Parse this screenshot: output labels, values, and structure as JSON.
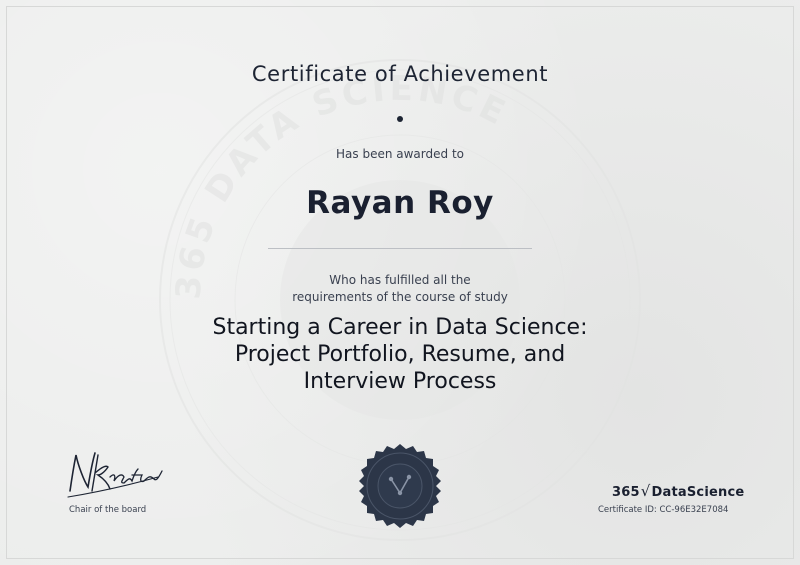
{
  "certificate": {
    "title": "Certificate of Achievement",
    "awarded_text": "Has been awarded to",
    "recipient": "Rayan Roy",
    "fulfilled_line1": "Who has fulfilled all the",
    "fulfilled_line2": "requirements of the course of study",
    "course_line1": "Starting a Career in Data Science:",
    "course_line2": "Project Portfolio, Resume, and",
    "course_line3": "Interview Process"
  },
  "signature": {
    "signer_text": "N.Krastev",
    "role": "Chair of the board"
  },
  "brand": {
    "prefix": "365",
    "root_symbol": "√",
    "name": "DataScience",
    "watermark_text": "365 DATA SCIENCE"
  },
  "certificate_id": "Certificate ID: CC-96E32E7084",
  "colors": {
    "background": "#ecedec",
    "text": "#1d2433",
    "seal": "#2c3648"
  }
}
